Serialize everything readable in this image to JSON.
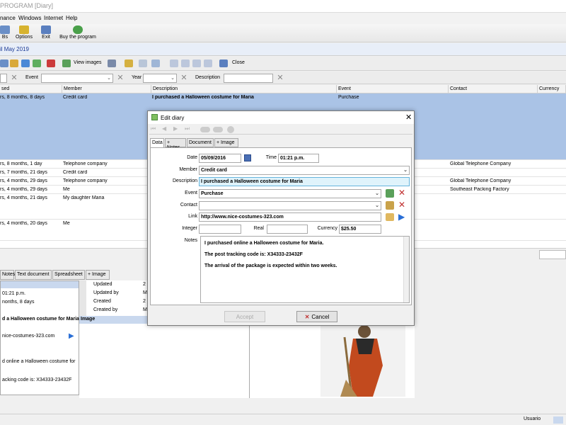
{
  "window": {
    "title": "PROGRAM [Diary]"
  },
  "menu": [
    "nance",
    "Windows",
    "Internet",
    "Help"
  ],
  "toolbar": {
    "items": [
      "Bs",
      "Options",
      "Exit",
      "Buy the program"
    ]
  },
  "date_header": "il May 2019",
  "nav": {
    "view_images": "View images",
    "close": "Close"
  },
  "filters": {
    "event_label": "Event",
    "year_label": "Year",
    "description_label": "Description"
  },
  "grid": {
    "headers": [
      "sed",
      "Member",
      "Description",
      "Event",
      "Contact",
      "Currency"
    ],
    "rows": [
      {
        "elapsed": "rs, 8 months, 8 days",
        "member": "Credit card",
        "description": "I purchased a Halloween costume for Maria",
        "event": "Purchase",
        "contact": "",
        "selected": true
      },
      {
        "elapsed": "rs, 8 months, 1 day",
        "member": "Telephone company",
        "description": "",
        "event": "",
        "contact": "Global Telephone Company"
      },
      {
        "elapsed": "rs, 7 months, 21 days",
        "member": "Credit card",
        "description": "",
        "event": "",
        "contact": ""
      },
      {
        "elapsed": "rs, 4 months, 29 days",
        "member": "Telephone company",
        "description": "",
        "event": "",
        "contact": "Global Telephone Company"
      },
      {
        "elapsed": "rs, 4 months, 29 days",
        "member": "Me",
        "description": "",
        "event": "",
        "contact": "Southeast Packing Factory"
      },
      {
        "elapsed": "rs, 4 months, 21 days",
        "member": "My daughter Maria",
        "description": "",
        "event": "",
        "contact": ""
      },
      {
        "elapsed": "rs, 4 months, 20 days",
        "member": "Me",
        "description": "",
        "event": "",
        "contact": ""
      }
    ]
  },
  "bottom_tabs": [
    "Notes",
    "Text document",
    "Spreadsheet",
    "+ Image"
  ],
  "left_panel": {
    "time": "01:21 p.m.",
    "elapsed": "nonths, 8 days",
    "description": "d a Halloween costume for Maria",
    "link": "nice-costumes-323.com",
    "notes_line1": "d online a Halloween costume for",
    "notes_line2": "acking code is: X34333-23432F"
  },
  "mid_panel": {
    "updated": "Updated",
    "updated_by": "Updated by",
    "created": "Created",
    "created_by": "Created by",
    "image": "Image",
    "updated_val": "2",
    "updated_by_val": "M",
    "created_val": "2",
    "created_by_val": "M"
  },
  "status": {
    "user": "Usuario"
  },
  "dialog": {
    "title": "Edit diary",
    "tabs": [
      "Data",
      "+ Notes",
      "Document",
      "+ Image"
    ],
    "fields": {
      "date_label": "Date",
      "date": "05/09/2016",
      "time_label": "Time",
      "time": "01:21 p.m.",
      "member_label": "Member",
      "member": "Credit card",
      "description_label": "Description",
      "description": "I purchased a Halloween costume for Maria",
      "event_label": "Event",
      "event": "Purchase",
      "contact_label": "Contact",
      "contact": "",
      "link_label": "Link",
      "link": "http://www.nice-costumes-323.com",
      "integer_label": "Integer",
      "integer": "",
      "real_label": "Real",
      "real": "",
      "currency_label": "Currency",
      "currency": "$25.50",
      "notes_label": "Notes",
      "notes": [
        "I purchased online a Halloween costume for Maria.",
        "The post tracking code is: X34333-23432F",
        "The arrival of the package is expected within two weeks."
      ]
    },
    "buttons": {
      "accept": "Accept",
      "cancel": "Cancel"
    }
  },
  "colors": {
    "selection": "#aac3e6",
    "accent": "#1e3c96",
    "description_highlight": "#dff3fb"
  }
}
